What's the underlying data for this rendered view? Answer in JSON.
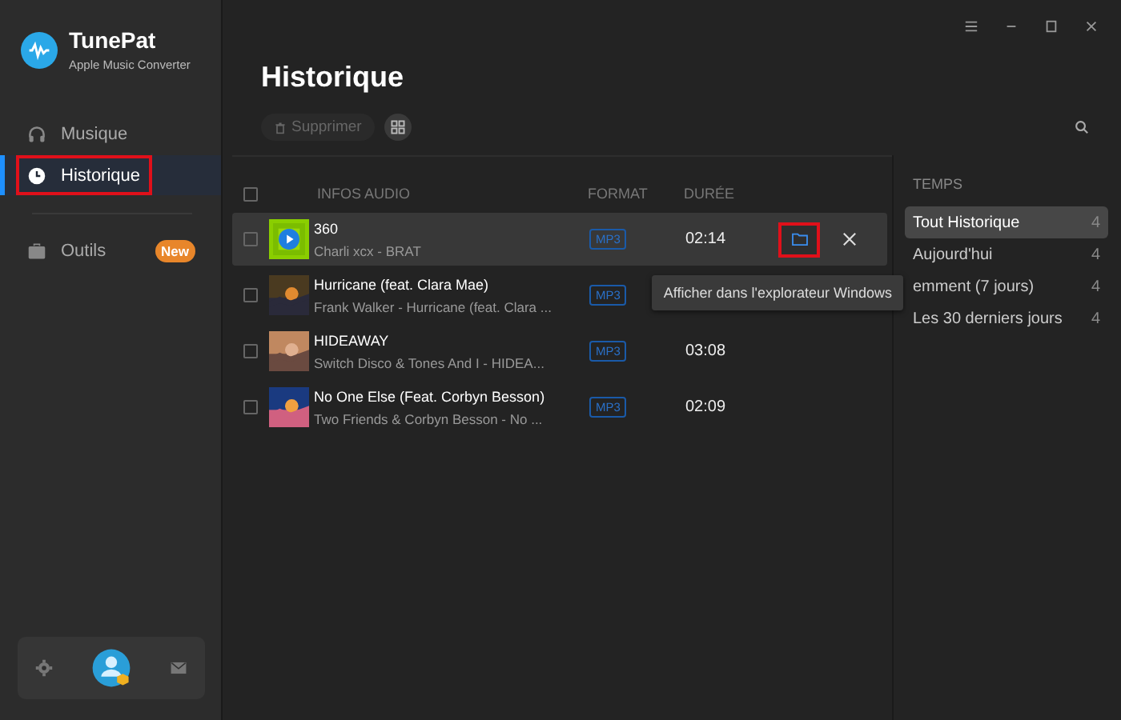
{
  "app": {
    "name": "TunePat",
    "subtitle": "Apple Music Converter"
  },
  "nav": [
    {
      "label": "Musique",
      "kind": "music",
      "selected": false,
      "highlighted": false
    },
    {
      "label": "Historique",
      "kind": "history",
      "selected": true,
      "highlighted": true
    },
    {
      "label": "Outils",
      "kind": "tools",
      "selected": false,
      "highlighted": false,
      "badge": "New"
    }
  ],
  "page": {
    "title": "Historique",
    "delete_button": "Supprimer"
  },
  "table": {
    "select_all_checked": false,
    "columns": [
      "INFOS AUDIO",
      "FORMAT",
      "DURÉE"
    ],
    "rows": [
      {
        "title": "360",
        "artist": "Charli xcx - BRAT",
        "format": "MP3",
        "duration": "02:14",
        "hovered": true,
        "checked": false,
        "folder_highlighted": true
      },
      {
        "title": "Hurricane (feat. Clara Mae)",
        "artist": "Frank Walker - Hurricane (feat. Clara ...",
        "format": "MP3",
        "hovered": false,
        "checked": false
      },
      {
        "title": "HIDEAWAY",
        "artist": "Switch Disco & Tones And I - HIDEA...",
        "format": "MP3",
        "duration": "03:08",
        "hovered": false,
        "checked": false
      },
      {
        "title": "No One Else (Feat. Corbyn Besson)",
        "artist": "Two Friends & Corbyn Besson - No ...",
        "format": "MP3",
        "duration": "02:09",
        "hovered": false,
        "checked": false
      }
    ]
  },
  "tooltip": "Afficher dans l'explorateur Windows",
  "filters": {
    "heading": "TEMPS",
    "items": [
      {
        "label": "Tout Historique",
        "count": "4",
        "selected": true
      },
      {
        "label": "Aujourd'hui",
        "count": "4",
        "selected": false
      },
      {
        "label": "emment (7 jours)",
        "count": "4",
        "selected": false
      },
      {
        "label": "Les 30 derniers jours",
        "count": "4",
        "selected": false
      }
    ]
  }
}
